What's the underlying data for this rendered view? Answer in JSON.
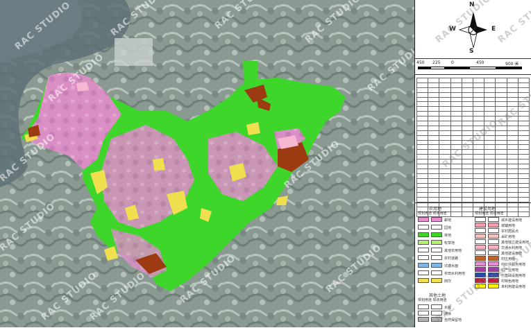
{
  "compass": {
    "n": "N",
    "s": "S",
    "e": "E",
    "w": "W"
  },
  "scale_bar": {
    "labels": [
      "450",
      "225",
      "0",
      "450",
      "900 米"
    ]
  },
  "watermark": "RAC STUDIO",
  "legend": {
    "agri_title": "农用地",
    "agri_cols": "规划用途 现状用途",
    "agri_items": [
      {
        "color": "#e58fcf",
        "label": "耕地"
      },
      {
        "color": "#ffffff",
        "label": "园地"
      },
      {
        "color": "#3fd62c",
        "label": "林地"
      },
      {
        "color": "#b4f06a",
        "label": "牧草地"
      },
      {
        "color": "#ffffff",
        "label": "其他农用地"
      },
      {
        "color": "#ffffff",
        "label": "农村道路"
      },
      {
        "color": "#7fb8e8",
        "label": "坑塘水面"
      },
      {
        "color": "#ffffff",
        "label": "农田水利用地"
      },
      {
        "color": "#f0e050",
        "label": "田坎"
      }
    ],
    "build_title": "建设用地",
    "build_cols": "规划用途 现状用途",
    "build_items": [
      {
        "color": "#ffffff",
        "label": "城乡建设用地"
      },
      {
        "color": "#f2a0b0",
        "label": "城镇用地"
      },
      {
        "color": "#ffffff",
        "label": "农村居民点"
      },
      {
        "color": "#f5c0c0",
        "label": "采矿用地"
      },
      {
        "color": "#ffffff",
        "label": "其他独立建设用地"
      },
      {
        "color": "#f7b0c0",
        "label": "交通水利用地"
      },
      {
        "color": "#ffffff",
        "label": "其他建设用地"
      },
      {
        "color": "#c0652a",
        "label": "村庄用地"
      },
      {
        "color": "#e08fd0",
        "label": "村公共服务用地"
      },
      {
        "color": "#a040a0",
        "label": "村产业用地"
      },
      {
        "color": "#2a4aa8",
        "label": "村基础设施用地"
      },
      {
        "color": "#c0203a",
        "label": "村特色用地"
      },
      {
        "color": "#fff000",
        "label": "未利用建设用地"
      }
    ],
    "other_title": "其他土地",
    "other_cols": "规划用途 现状用途",
    "other_items": [
      {
        "color": "#ffffff",
        "label": "水域"
      },
      {
        "color": "#ffffff",
        "label": "滩涂"
      },
      {
        "color": "#b0b0b0",
        "label": "自然保留地"
      }
    ]
  }
}
